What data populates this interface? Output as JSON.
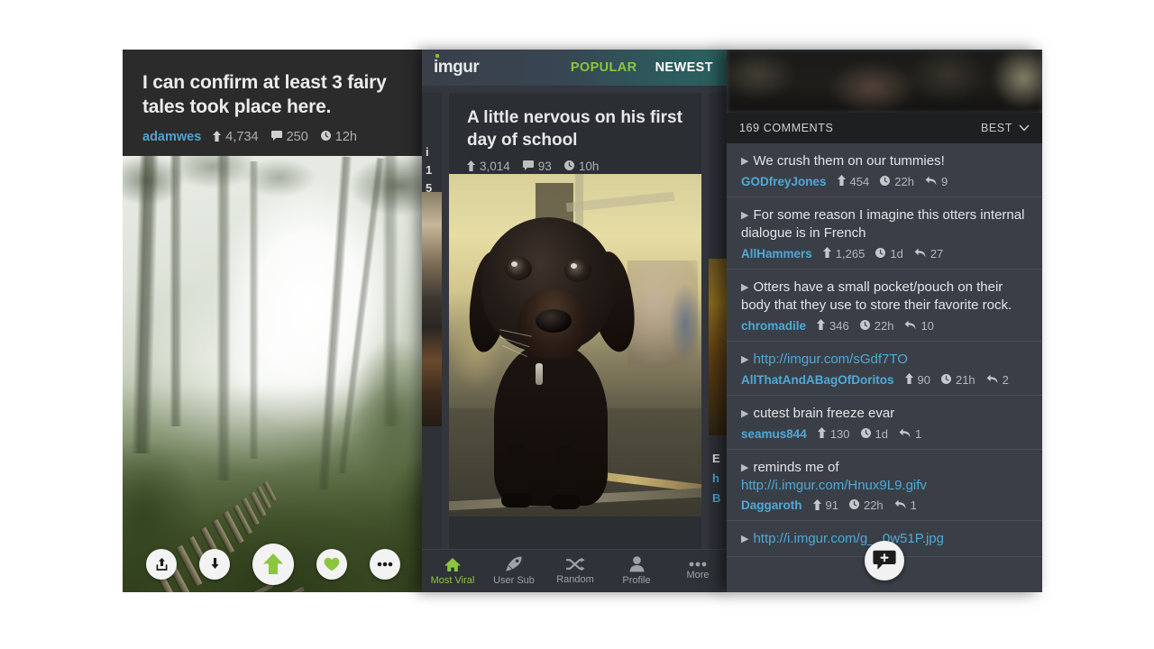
{
  "left_panel": {
    "post_title": "I can confirm at least 3 fairy tales took place here.",
    "username": "adamwes",
    "points": "4,734",
    "comments": "250",
    "time": "12h",
    "image_alt": "foggy forest railway track",
    "actions": [
      {
        "name": "share-button",
        "icon": "share-icon"
      },
      {
        "name": "download-button",
        "icon": "download-arrow-icon"
      },
      {
        "name": "upvote-button",
        "icon": "upvote-arrow-icon"
      },
      {
        "name": "favorite-button",
        "icon": "heart-icon"
      },
      {
        "name": "more-button",
        "icon": "ellipsis-icon"
      }
    ]
  },
  "center_panel": {
    "brand": "imgur",
    "nav": [
      {
        "label": "POPULAR",
        "active": true
      },
      {
        "label": "NEWEST",
        "active": false
      }
    ],
    "post_title": "A little nervous on his first day of school",
    "points": "3,014",
    "comments": "93",
    "time": "10h",
    "image_alt": "black labrador puppy",
    "peek_left_fragments": [
      "i",
      "1",
      "5"
    ],
    "peek_right_fragments": [
      "E",
      "h",
      "B"
    ],
    "bottom_nav": [
      {
        "label": "Most Viral",
        "icon": "home-icon",
        "active": true
      },
      {
        "label": "User Sub",
        "icon": "rocket-icon",
        "active": false
      },
      {
        "label": "Random",
        "icon": "shuffle-icon",
        "active": false
      },
      {
        "label": "Profile",
        "icon": "person-icon",
        "active": false
      },
      {
        "label": "More",
        "icon": "ellipsis-icon",
        "active": false
      }
    ]
  },
  "right_panel": {
    "comment_count_label": "169 COMMENTS",
    "sort_label": "BEST",
    "comments": [
      {
        "text": "We crush them on our tummies!",
        "is_link": false,
        "username": "GODfreyJones",
        "points": "454",
        "time": "22h",
        "replies": "9"
      },
      {
        "text": "For some reason I imagine this otters internal dialogue is in French",
        "is_link": false,
        "username": "AllHammers",
        "points": "1,265",
        "time": "1d",
        "replies": "27"
      },
      {
        "text": "Otters have a small pocket/pouch on their body that they use to store their favorite rock.",
        "is_link": false,
        "username": "chromadile",
        "points": "346",
        "time": "22h",
        "replies": "10"
      },
      {
        "text": "http://imgur.com/sGdf7TO",
        "is_link": true,
        "username": "AllThatAndABagOfDoritos",
        "points": "90",
        "time": "21h",
        "replies": "2"
      },
      {
        "text": "cutest brain freeze evar",
        "is_link": false,
        "username": "seamus844",
        "points": "130",
        "time": "1d",
        "replies": "1"
      },
      {
        "text": "reminds me of ",
        "link_text": "http://i.imgur.com/Hnux9L9.gifv",
        "is_link": false,
        "username": "Daggaroth",
        "points": "91",
        "time": "22h",
        "replies": "1"
      },
      {
        "text": "http://i.imgur.com/g__0w51P.jpg",
        "is_link": true,
        "username": "",
        "points": "",
        "time": "",
        "replies": ""
      }
    ],
    "fab": {
      "name": "add-comment-button",
      "icon": "comment-plus-icon"
    }
  },
  "colors": {
    "accent_green": "#8cc63f",
    "link_blue": "#4fa9d6",
    "panel_dark": "#2b2b2b",
    "comment_panel": "#3a3f47"
  }
}
